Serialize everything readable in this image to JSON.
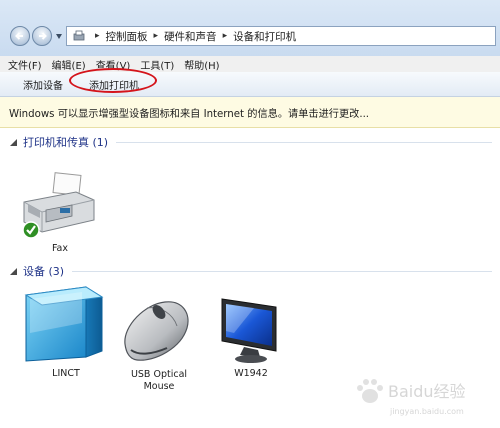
{
  "address": {
    "breadcrumbs": [
      "控制面板",
      "硬件和声音",
      "设备和打印机"
    ]
  },
  "menu": [
    "文件(F)",
    "编辑(E)",
    "查看(V)",
    "工具(T)",
    "帮助(H)"
  ],
  "commands": {
    "add_device": "添加设备",
    "add_printer": "添加打印机"
  },
  "infobar": {
    "text": "Windows 可以显示增强型设备图标和来自 Internet 的信息。请单击进行更改..."
  },
  "groups": {
    "printers": {
      "title": "打印机和传真 (1)",
      "items": [
        {
          "label": "Fax"
        }
      ]
    },
    "devices": {
      "title": "设备 (3)",
      "items": [
        {
          "label": "LINCT"
        },
        {
          "label_line1": "USB Optical",
          "label_line2": "Mouse"
        },
        {
          "label": "W1942"
        }
      ]
    }
  },
  "colors": {
    "group_title": "#1e3287",
    "highlight_ring": "#d4141b",
    "infobar_bg": "#fefbe3"
  },
  "watermark": {
    "text": "Baidu经验",
    "url": "jingyan.baidu.com"
  }
}
